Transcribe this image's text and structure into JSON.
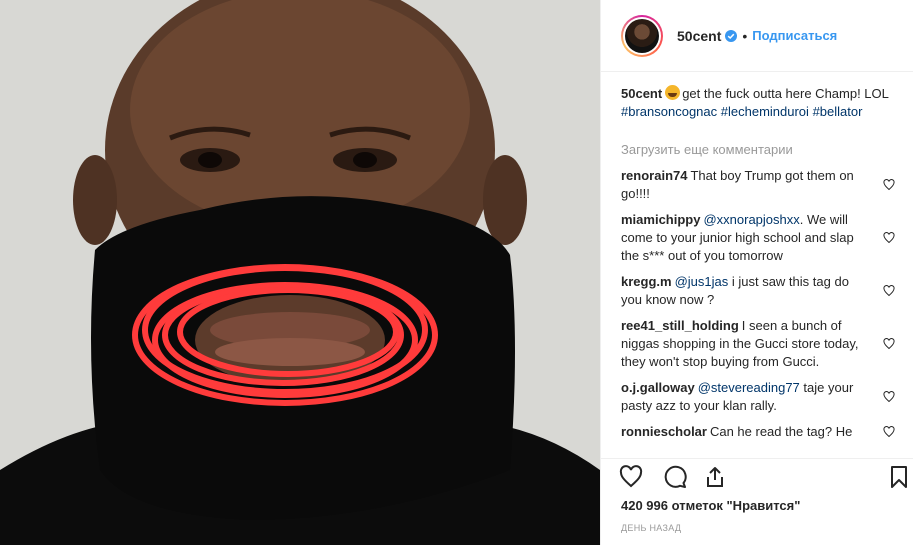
{
  "post": {
    "author": "50cent",
    "follow_label": "Подписаться",
    "dot": "•",
    "caption": {
      "text": "get the fuck outta here Champ! LOL",
      "hashtags": [
        "#bransoncognac",
        "#lecheminduroi",
        "#bellator"
      ]
    },
    "load_more": "Загрузить еще комментарии",
    "likes": "420 996 отметок \"Нравится\"",
    "time": "ДЕНЬ НАЗАД"
  },
  "comments": [
    {
      "user": "renorain74",
      "mention": "",
      "text": "That boy Trump got them on go!!!!"
    },
    {
      "user": "miamichippy",
      "mention": "@xxnorapjoshxx",
      "text": ". We will come to your junior high school and slap the s*** out of you tomorrow"
    },
    {
      "user": "kregg.m",
      "mention": "@jus1jas",
      "text": " i just saw this tag do you know now ?"
    },
    {
      "user": "ree41_still_holding",
      "mention": "",
      "text": "I seen a bunch of niggas shopping in the Gucci store today, they won't stop buying from Gucci."
    },
    {
      "user": "o.j.galloway",
      "mention": "@stevereading77",
      "text": " taje your pasty azz to your klan rally."
    },
    {
      "user": "ronniescholar",
      "mention": "",
      "text": "Can he read the tag? He"
    }
  ],
  "icons": {
    "like": "heart-icon",
    "comment": "comment-icon",
    "share": "share-icon",
    "save": "bookmark-icon",
    "verified": "verified-badge-icon"
  },
  "colors": {
    "accent": "#3897f0",
    "hashtag": "#003569",
    "muted": "#999999",
    "drawn_red": "#ff3b3b"
  }
}
